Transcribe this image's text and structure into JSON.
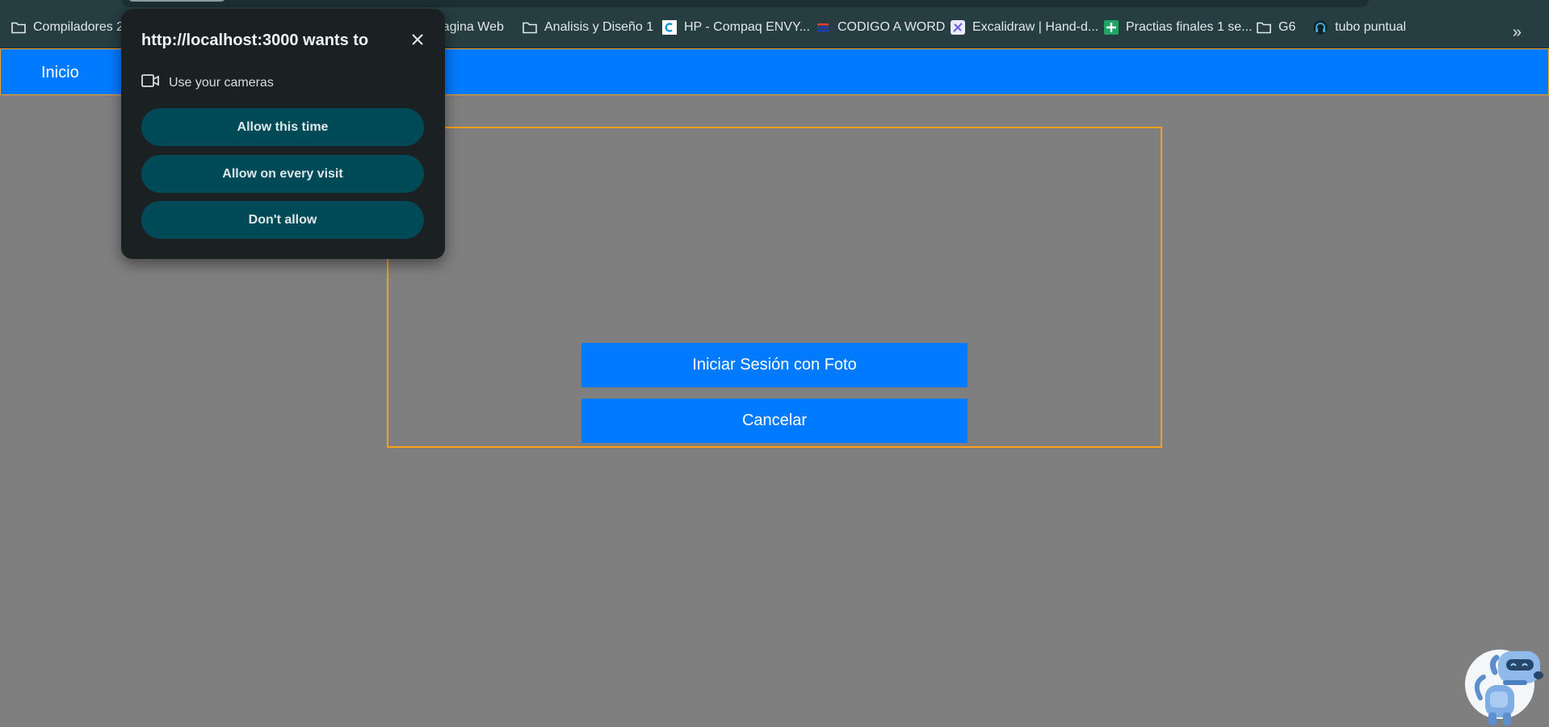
{
  "bookmarks": [
    {
      "label": "Compiladores 2",
      "icon": "folder-icon"
    },
    {
      "label": "Pagina Web",
      "icon": "folder-icon"
    },
    {
      "label": "Analisis y Diseño 1",
      "icon": "folder-icon"
    },
    {
      "label": "HP - Compaq ENVY...",
      "icon": "site-favicon"
    },
    {
      "label": "CODIGO A WORD",
      "icon": "site-favicon"
    },
    {
      "label": "Excalidraw | Hand-d...",
      "icon": "excalidraw-favicon"
    },
    {
      "label": "Practias finales 1 se...",
      "icon": "sheets-favicon"
    },
    {
      "label": "G6",
      "icon": "folder-icon"
    },
    {
      "label": "tubo puntual",
      "icon": "site-favicon"
    }
  ],
  "navbar": {
    "home_label": "Inicio",
    "color": "#007bff",
    "border_color": "#ff9f1a"
  },
  "main": {
    "photo_login_label": "Iniciar Sesión con Foto",
    "cancel_label": "Cancelar"
  },
  "permission_popup": {
    "title": "http://localhost:3000 wants to",
    "permission_text": "Use your cameras",
    "allow_once_label": "Allow this time",
    "allow_always_label": "Allow on every visit",
    "deny_label": "Don't allow"
  }
}
